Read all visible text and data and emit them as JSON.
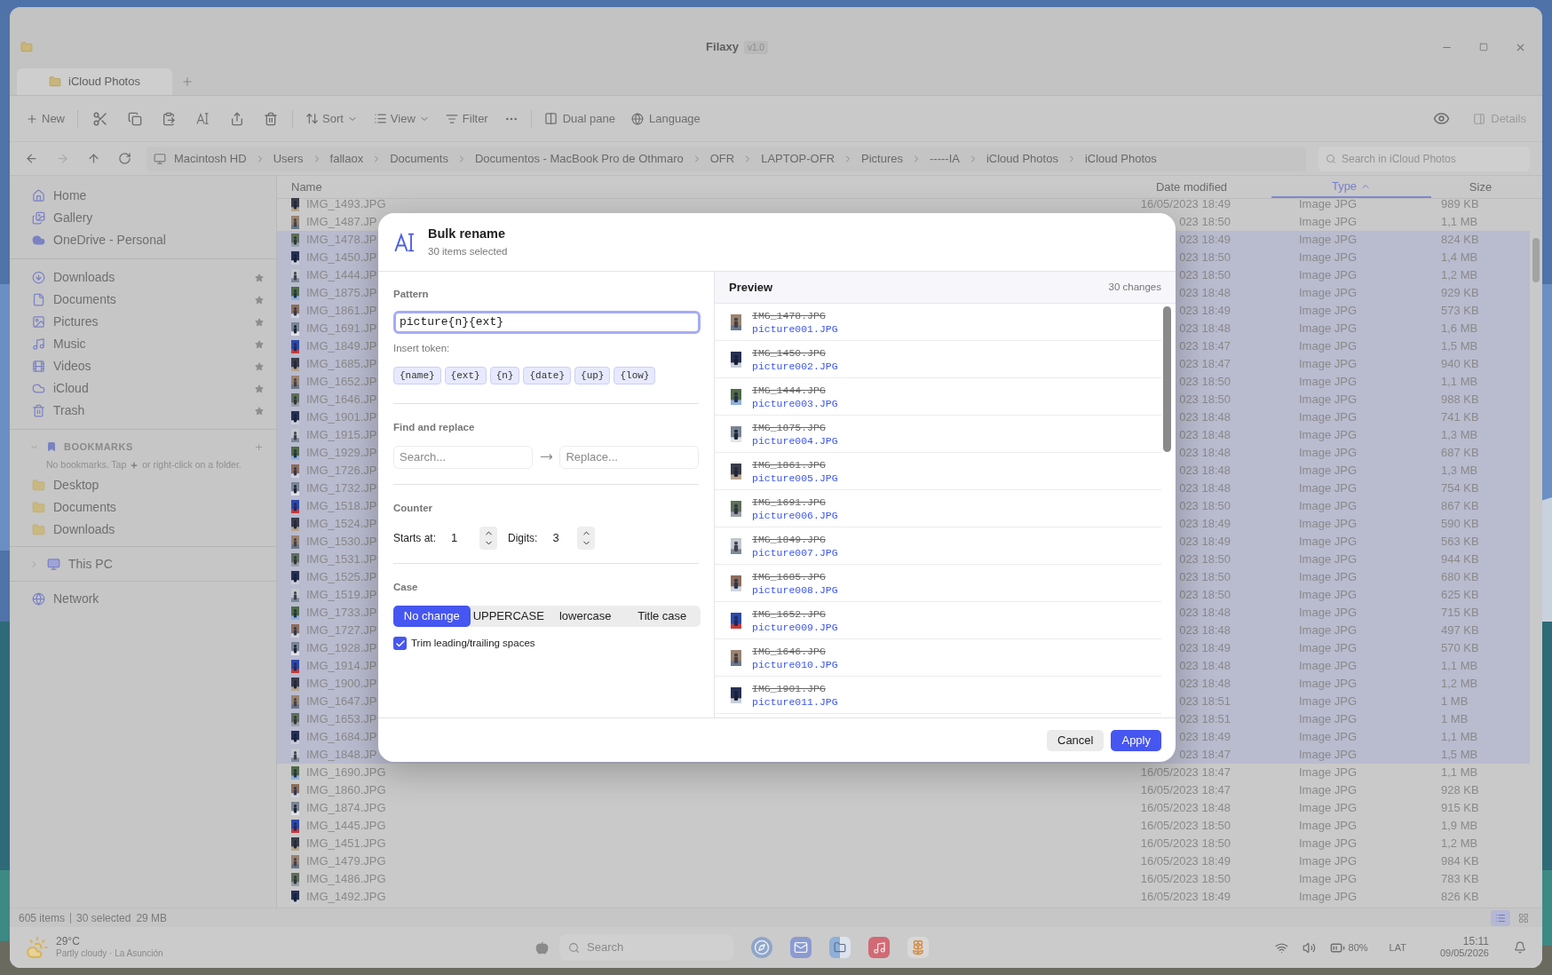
{
  "window": {
    "title": "Filaxy",
    "version": "v1.0"
  },
  "tabs": [
    {
      "label": "iCloud Photos",
      "selected": true
    }
  ],
  "toolbar": {
    "new": "New",
    "sort": "Sort",
    "view": "View",
    "filter": "Filter",
    "dual_pane": "Dual pane",
    "language": "Language",
    "details": {
      "label": "Details",
      "disabled": true
    }
  },
  "nav": [
    {
      "kind": "back",
      "disabled": false
    },
    {
      "kind": "forward",
      "disabled": true
    },
    {
      "kind": "up",
      "disabled": false
    },
    {
      "kind": "refresh",
      "disabled": false
    }
  ],
  "breadcrumbs": [
    "Macintosh HD",
    "Users",
    "fallaox",
    "Documents",
    "Documentos - MacBook Pro de Othmaro",
    "OFR",
    "LAPTOP-OFR",
    "Pictures",
    "-----IA",
    "iCloud Photos",
    "iCloud Photos"
  ],
  "search": {
    "placeholder": "Search in iCloud Photos"
  },
  "sidebar": {
    "places": [
      {
        "label": "Home",
        "kind": "home"
      },
      {
        "label": "Gallery",
        "kind": "gallery"
      },
      {
        "label": "OneDrive - Personal",
        "kind": "cloud"
      }
    ],
    "pinned": [
      {
        "label": "Downloads",
        "kind": "downloads",
        "pinned": true
      },
      {
        "label": "Documents",
        "kind": "documents",
        "pinned": true
      },
      {
        "label": "Pictures",
        "kind": "pictures",
        "pinned": true
      },
      {
        "label": "Music",
        "kind": "music",
        "pinned": true
      },
      {
        "label": "Videos",
        "kind": "videos",
        "pinned": true
      },
      {
        "label": "iCloud",
        "kind": "icloud",
        "pinned": true
      },
      {
        "label": "Trash",
        "kind": "trash",
        "pinned": true
      }
    ],
    "bookmarks": {
      "title": "BOOKMARKS",
      "expanded": true,
      "hint_before": "No bookmarks. Tap",
      "hint_after": "or right-click on a folder.",
      "items": [
        "Desktop",
        "Documents",
        "Downloads"
      ]
    },
    "this_pc": {
      "label": "This PC",
      "expanded": false
    },
    "network": {
      "label": "Network"
    }
  },
  "columns": [
    {
      "label": "Name",
      "selected": false
    },
    {
      "label": "Date modified",
      "selected": false
    },
    {
      "label": "Type",
      "selected": true,
      "sort_ascending": true
    },
    {
      "label": "Size",
      "selected": false
    }
  ],
  "rows": [
    {
      "name": "IMG_1493.JPG",
      "date": "16/05/2023 18:49",
      "type": "Image JPG",
      "size": "989 KB",
      "selected": false
    },
    {
      "name": "IMG_1487.JP",
      "date": "023 18:50",
      "type": "Image JPG",
      "size": "1,1 MB",
      "selected": false
    },
    {
      "name": "IMG_1478.JP",
      "date": "023 18:49",
      "type": "Image JPG",
      "size": "824 KB",
      "selected": true
    },
    {
      "name": "IMG_1450.JP",
      "date": "023 18:50",
      "type": "Image JPG",
      "size": "1,4 MB",
      "selected": true
    },
    {
      "name": "IMG_1444.JP",
      "date": "023 18:50",
      "type": "Image JPG",
      "size": "1,2 MB",
      "selected": true
    },
    {
      "name": "IMG_1875.JP",
      "date": "023 18:48",
      "type": "Image JPG",
      "size": "929 KB",
      "selected": true
    },
    {
      "name": "IMG_1861.JP",
      "date": "023 18:49",
      "type": "Image JPG",
      "size": "573 KB",
      "selected": true
    },
    {
      "name": "IMG_1691.JP",
      "date": "023 18:48",
      "type": "Image JPG",
      "size": "1,6 MB",
      "selected": true
    },
    {
      "name": "IMG_1849.JP",
      "date": "023 18:47",
      "type": "Image JPG",
      "size": "1,5 MB",
      "selected": true
    },
    {
      "name": "IMG_1685.JP",
      "date": "023 18:47",
      "type": "Image JPG",
      "size": "940 KB",
      "selected": true
    },
    {
      "name": "IMG_1652.JP",
      "date": "023 18:50",
      "type": "Image JPG",
      "size": "1,1 MB",
      "selected": true
    },
    {
      "name": "IMG_1646.JP",
      "date": "023 18:50",
      "type": "Image JPG",
      "size": "988 KB",
      "selected": true
    },
    {
      "name": "IMG_1901.JP",
      "date": "023 18:48",
      "type": "Image JPG",
      "size": "741 KB",
      "selected": true
    },
    {
      "name": "IMG_1915.JP",
      "date": "023 18:48",
      "type": "Image JPG",
      "size": "1,3 MB",
      "selected": true
    },
    {
      "name": "IMG_1929.JP",
      "date": "023 18:48",
      "type": "Image JPG",
      "size": "687 KB",
      "selected": true
    },
    {
      "name": "IMG_1726.JP",
      "date": "023 18:48",
      "type": "Image JPG",
      "size": "1,3 MB",
      "selected": true
    },
    {
      "name": "IMG_1732.JP",
      "date": "023 18:48",
      "type": "Image JPG",
      "size": "754 KB",
      "selected": true
    },
    {
      "name": "IMG_1518.JP",
      "date": "023 18:50",
      "type": "Image JPG",
      "size": "867 KB",
      "selected": true
    },
    {
      "name": "IMG_1524.JP",
      "date": "023 18:49",
      "type": "Image JPG",
      "size": "590 KB",
      "selected": true
    },
    {
      "name": "IMG_1530.JP",
      "date": "023 18:49",
      "type": "Image JPG",
      "size": "563 KB",
      "selected": true
    },
    {
      "name": "IMG_1531.JP",
      "date": "023 18:50",
      "type": "Image JPG",
      "size": "944 KB",
      "selected": true
    },
    {
      "name": "IMG_1525.JP",
      "date": "023 18:50",
      "type": "Image JPG",
      "size": "680 KB",
      "selected": true
    },
    {
      "name": "IMG_1519.JP",
      "date": "023 18:50",
      "type": "Image JPG",
      "size": "625 KB",
      "selected": true
    },
    {
      "name": "IMG_1733.JP",
      "date": "023 18:48",
      "type": "Image JPG",
      "size": "715 KB",
      "selected": true
    },
    {
      "name": "IMG_1727.JP",
      "date": "023 18:48",
      "type": "Image JPG",
      "size": "497 KB",
      "selected": true
    },
    {
      "name": "IMG_1928.JP",
      "date": "023 18:49",
      "type": "Image JPG",
      "size": "570 KB",
      "selected": true
    },
    {
      "name": "IMG_1914.JP",
      "date": "023 18:48",
      "type": "Image JPG",
      "size": "1,1 MB",
      "selected": true
    },
    {
      "name": "IMG_1900.JP",
      "date": "023 18:48",
      "type": "Image JPG",
      "size": "1,2 MB",
      "selected": true
    },
    {
      "name": "IMG_1647.JP",
      "date": "023 18:51",
      "type": "Image JPG",
      "size": "1 MB",
      "selected": true
    },
    {
      "name": "IMG_1653.JP",
      "date": "023 18:51",
      "type": "Image JPG",
      "size": "1 MB",
      "selected": true
    },
    {
      "name": "IMG_1684.JP",
      "date": "023 18:49",
      "type": "Image JPG",
      "size": "1,1 MB",
      "selected": true
    },
    {
      "name": "IMG_1848.JP",
      "date": "023 18:47",
      "type": "Image JPG",
      "size": "1,5 MB",
      "selected": true
    },
    {
      "name": "IMG_1690.JPG",
      "date": "16/05/2023 18:47",
      "type": "Image JPG",
      "size": "1,1 MB",
      "selected": false
    },
    {
      "name": "IMG_1860.JPG",
      "date": "16/05/2023 18:47",
      "type": "Image JPG",
      "size": "928 KB",
      "selected": false
    },
    {
      "name": "IMG_1874.JPG",
      "date": "16/05/2023 18:48",
      "type": "Image JPG",
      "size": "915 KB",
      "selected": false
    },
    {
      "name": "IMG_1445.JPG",
      "date": "16/05/2023 18:50",
      "type": "Image JPG",
      "size": "1,9 MB",
      "selected": false
    },
    {
      "name": "IMG_1451.JPG",
      "date": "16/05/2023 18:50",
      "type": "Image JPG",
      "size": "1,2 MB",
      "selected": false
    },
    {
      "name": "IMG_1479.JPG",
      "date": "16/05/2023 18:49",
      "type": "Image JPG",
      "size": "984 KB",
      "selected": false
    },
    {
      "name": "IMG_1486.JPG",
      "date": "16/05/2023 18:50",
      "type": "Image JPG",
      "size": "783 KB",
      "selected": false
    },
    {
      "name": "IMG_1492.JPG",
      "date": "16/05/2023 18:49",
      "type": "Image JPG",
      "size": "826 KB",
      "selected": false
    }
  ],
  "status_bar": {
    "items": "605 items",
    "selected": "30 selected",
    "size": "29 MB",
    "views": [
      {
        "kind": "list",
        "selected": true
      },
      {
        "kind": "grid",
        "selected": false
      }
    ]
  },
  "taskbar": {
    "temperature": "29°C",
    "weather": "Partly cloudy · La Asunción",
    "search_placeholder": "Search",
    "apps": [
      {
        "kind": "compass"
      },
      {
        "kind": "mail"
      },
      {
        "kind": "finder"
      },
      {
        "kind": "music"
      },
      {
        "kind": "photos"
      }
    ],
    "battery": "80%",
    "input_language": "LAT",
    "time": "15:11",
    "date": "09/05/2026"
  },
  "dialog": {
    "title": "Bulk rename",
    "subtitle": "30 items selected",
    "pattern_label": "Pattern",
    "pattern_value": "picture{n}{ext}",
    "token_label": "Insert token:",
    "tokens": [
      "{name}",
      "{ext}",
      "{n}",
      "{date}",
      "{up}",
      "{low}"
    ],
    "find_label": "Find and replace",
    "find_placeholder": "Search...",
    "replace_placeholder": "Replace...",
    "counter_label": "Counter",
    "starts_label": "Starts at:",
    "starts_value": "1",
    "digits_label": "Digits:",
    "digits_value": "3",
    "case_label": "Case",
    "case_options": [
      {
        "label": "No change",
        "selected": true
      },
      {
        "label": "UPPERCASE",
        "selected": false
      },
      {
        "label": "lowercase",
        "selected": false
      },
      {
        "label": "Title case",
        "selected": false
      }
    ],
    "trim": {
      "label": "Trim leading/trailing spaces",
      "checked": true
    },
    "preview_label": "Preview",
    "preview_count": "30 changes",
    "preview": [
      {
        "old": "IMG_1478.JPG",
        "new": "picture001.JPG"
      },
      {
        "old": "IMG_1450.JPG",
        "new": "picture002.JPG"
      },
      {
        "old": "IMG_1444.JPG",
        "new": "picture003.JPG"
      },
      {
        "old": "IMG_1875.JPG",
        "new": "picture004.JPG"
      },
      {
        "old": "IMG_1861.JPG",
        "new": "picture005.JPG"
      },
      {
        "old": "IMG_1691.JPG",
        "new": "picture006.JPG"
      },
      {
        "old": "IMG_1849.JPG",
        "new": "picture007.JPG"
      },
      {
        "old": "IMG_1685.JPG",
        "new": "picture008.JPG"
      },
      {
        "old": "IMG_1652.JPG",
        "new": "picture009.JPG"
      },
      {
        "old": "IMG_1646.JPG",
        "new": "picture010.JPG"
      },
      {
        "old": "IMG_1901.JPG",
        "new": "picture011.JPG"
      }
    ],
    "cancel": "Cancel",
    "apply": "Apply"
  }
}
